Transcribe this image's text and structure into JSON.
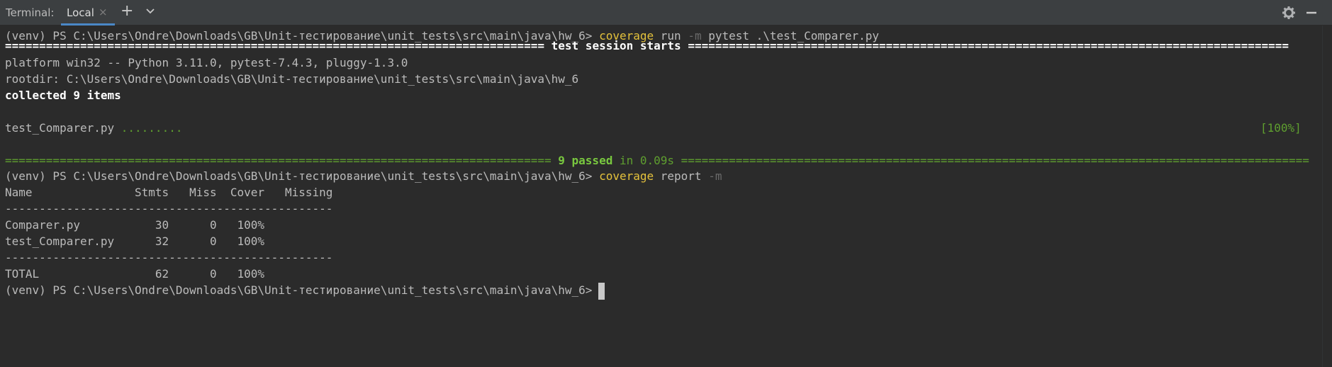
{
  "tabbar": {
    "title": "Terminal:",
    "tab_label": "Local",
    "close_glyph": "×",
    "add_glyph": "+",
    "icons": [
      "close-icon",
      "plus-icon",
      "chevron-down-icon",
      "gear-icon",
      "minimize-icon"
    ]
  },
  "terminal": {
    "prompt": "(venv) PS C:\\Users\\Ondre\\Downloads\\GB\\Unit-тестирование\\unit_tests\\src\\main\\java\\hw_6>",
    "cmd1": {
      "tool": "coverage",
      "sub": "run",
      "flag": "-m",
      "rest": "pytest .\\test_Comparer.py"
    },
    "session_rule_left": "===============================================================================",
    "session_title": "test session starts",
    "session_rule_right": "========================================================================================",
    "platform": "platform win32 -- Python 3.11.0, pytest-7.4.3, pluggy-1.3.0",
    "rootdir": "rootdir: C:\\Users\\Ondre\\Downloads\\GB\\Unit-тестирование\\unit_tests\\src\\main\\java\\hw_6",
    "collected": "collected 9 items",
    "test_file": "test_Comparer.py",
    "test_dots": ".........",
    "progress": "[100%]",
    "result_rule_left": "================================================================================",
    "passed": "9 passed",
    "in_time": "in 0.09s",
    "result_rule_right": "============================================================================================",
    "cmd2": {
      "tool": "coverage",
      "sub": "report",
      "flag": "-m"
    },
    "report_header": "Name               Stmts   Miss  Cover   Missing",
    "separator": "------------------------------------------------",
    "rows": [
      "Comparer.py           30      0   100%",
      "test_Comparer.py      32      0   100%"
    ],
    "total": "TOTAL                 62      0   100%",
    "accent": "#4a88c7",
    "yellow": "#e4c23c",
    "green": "#79c83f"
  }
}
